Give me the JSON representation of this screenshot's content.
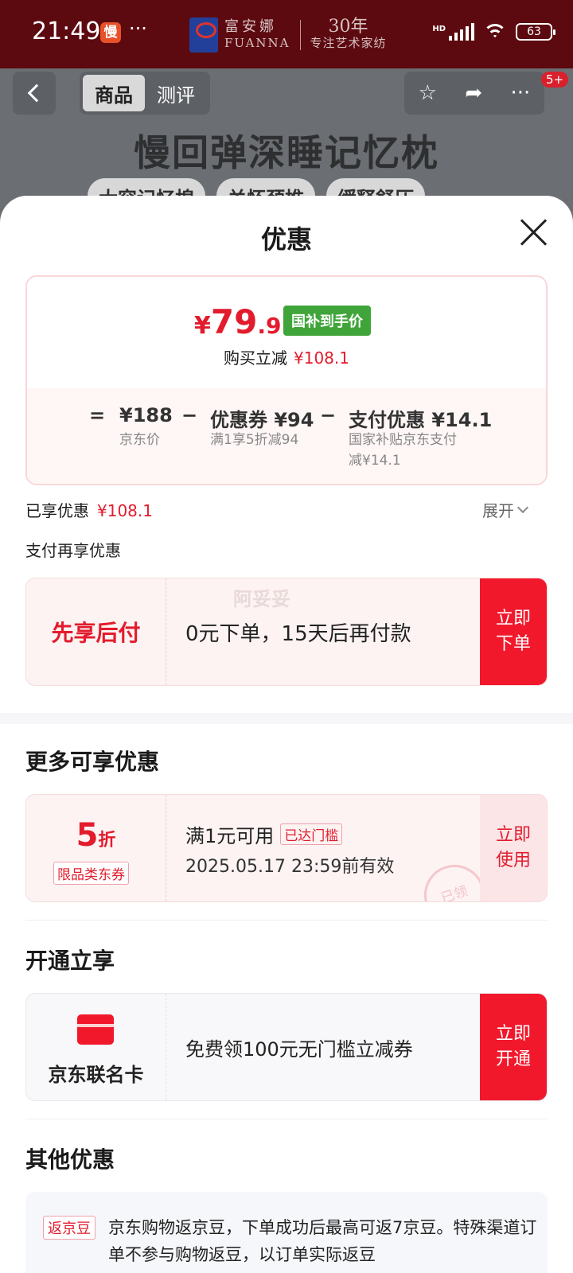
{
  "status_bar": {
    "time": "21:49",
    "app_badge": "慢",
    "dots": "···",
    "brand_cn": "富安娜",
    "brand_en": "FUANNA",
    "brand_30": "30年",
    "brand_slogan": "专注艺术家纺",
    "hd": "HD",
    "battery": "63"
  },
  "product_header": {
    "tabs": [
      "商品",
      "测评"
    ],
    "more_badge": "5+",
    "title": "慢回弹深睡记忆枕",
    "chips": [
      "大容记忆棉",
      "关怀颈椎",
      "缓释舒压"
    ]
  },
  "sheet": {
    "title": "优惠",
    "price": {
      "currency": "¥",
      "integer": "79",
      "decimal": ".9",
      "tag": "国补到手价",
      "reduce_label": "购买立减",
      "reduce_amount": "¥108.1"
    },
    "formula": {
      "eq": "=",
      "jd_price": "¥188",
      "jd_price_label": "京东价",
      "minus1": "−",
      "coupon": "优惠券 ¥94",
      "coupon_desc": "满1享5折减94",
      "minus2": "−",
      "pay": "支付优惠 ¥14.1",
      "pay_desc_1": "国家补贴京东支付",
      "pay_desc_2": "减¥14.1"
    },
    "enjoyed_label": "已享优惠",
    "enjoyed_amount": "¥108.1",
    "expand": "展开",
    "pay_more": "支付再享优惠",
    "bnpl": {
      "label": "先享后付",
      "text": "0元下单，15天后再付款",
      "watermark": "阿妥妥",
      "cta_1": "立即",
      "cta_2": "下单"
    },
    "more_title": "更多可享优惠",
    "coupon": {
      "rate_num": "5",
      "rate_unit": "折",
      "type": "限品类东券",
      "condition": "满1元可用",
      "status": "已达门槛",
      "expiry": "2025.05.17  23:59前有效",
      "cta_1": "立即",
      "cta_2": "使用",
      "stamp": "已领"
    },
    "open_title": "开通立享",
    "card": {
      "name": "京东联名卡",
      "text": "免费领100元无门槛立减券",
      "cta_1": "立即",
      "cta_2": "开通"
    },
    "other_title": "其他优惠",
    "other": {
      "tag": "返京豆",
      "text": "京东购物返京豆，下单成功后最高可返7京豆。特殊渠道订单不参与购物返豆，以订单实际返豆"
    }
  },
  "colors": {
    "accent": "#f2182c",
    "price_red": "#e21c2c",
    "subsidy_green": "#3fa53a"
  }
}
